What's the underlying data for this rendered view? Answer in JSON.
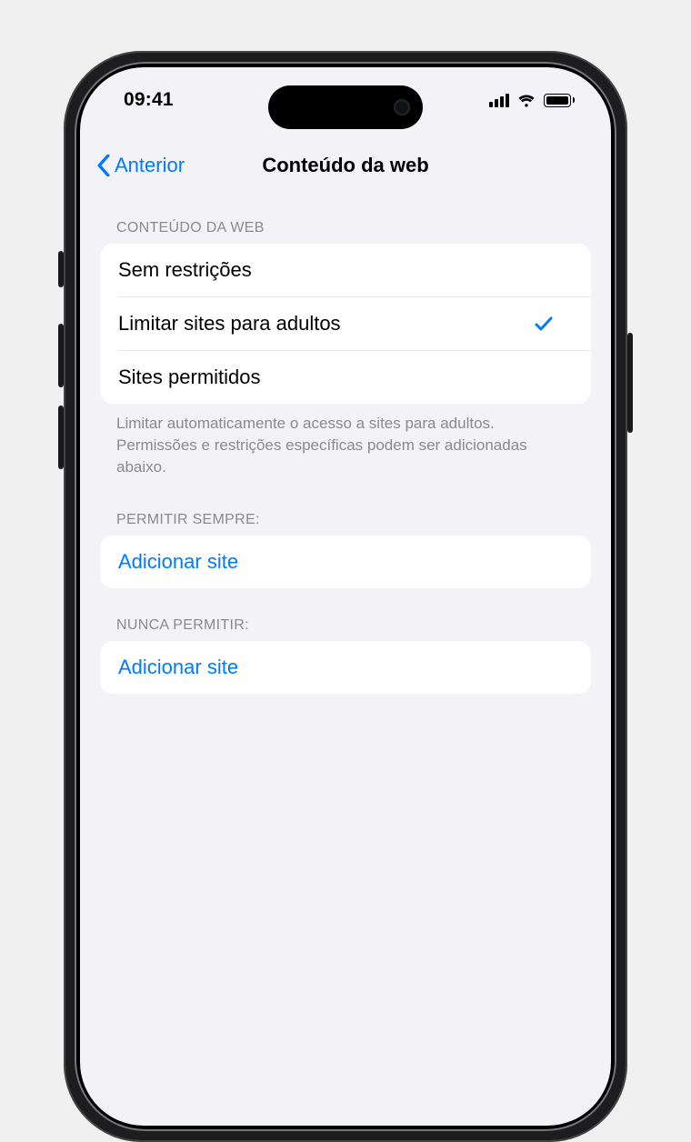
{
  "status": {
    "time": "09:41"
  },
  "nav": {
    "back_label": "Anterior",
    "title": "Conteúdo da web"
  },
  "sections": {
    "web_content": {
      "header": "CONTEÚDO DA WEB",
      "options": [
        {
          "label": "Sem restrições",
          "selected": false
        },
        {
          "label": "Limitar sites para adultos",
          "selected": true
        },
        {
          "label": "Sites permitidos",
          "selected": false
        }
      ],
      "footer": "Limitar automaticamente o acesso a sites para adultos. Permissões e restrições específicas podem ser adicionadas abaixo."
    },
    "always_allow": {
      "header": "PERMITIR SEMPRE:",
      "add_label": "Adicionar site"
    },
    "never_allow": {
      "header": "NUNCA PERMITIR:",
      "add_label": "Adicionar site"
    }
  },
  "colors": {
    "accent": "#007aff",
    "bg": "#f2f2f7"
  }
}
